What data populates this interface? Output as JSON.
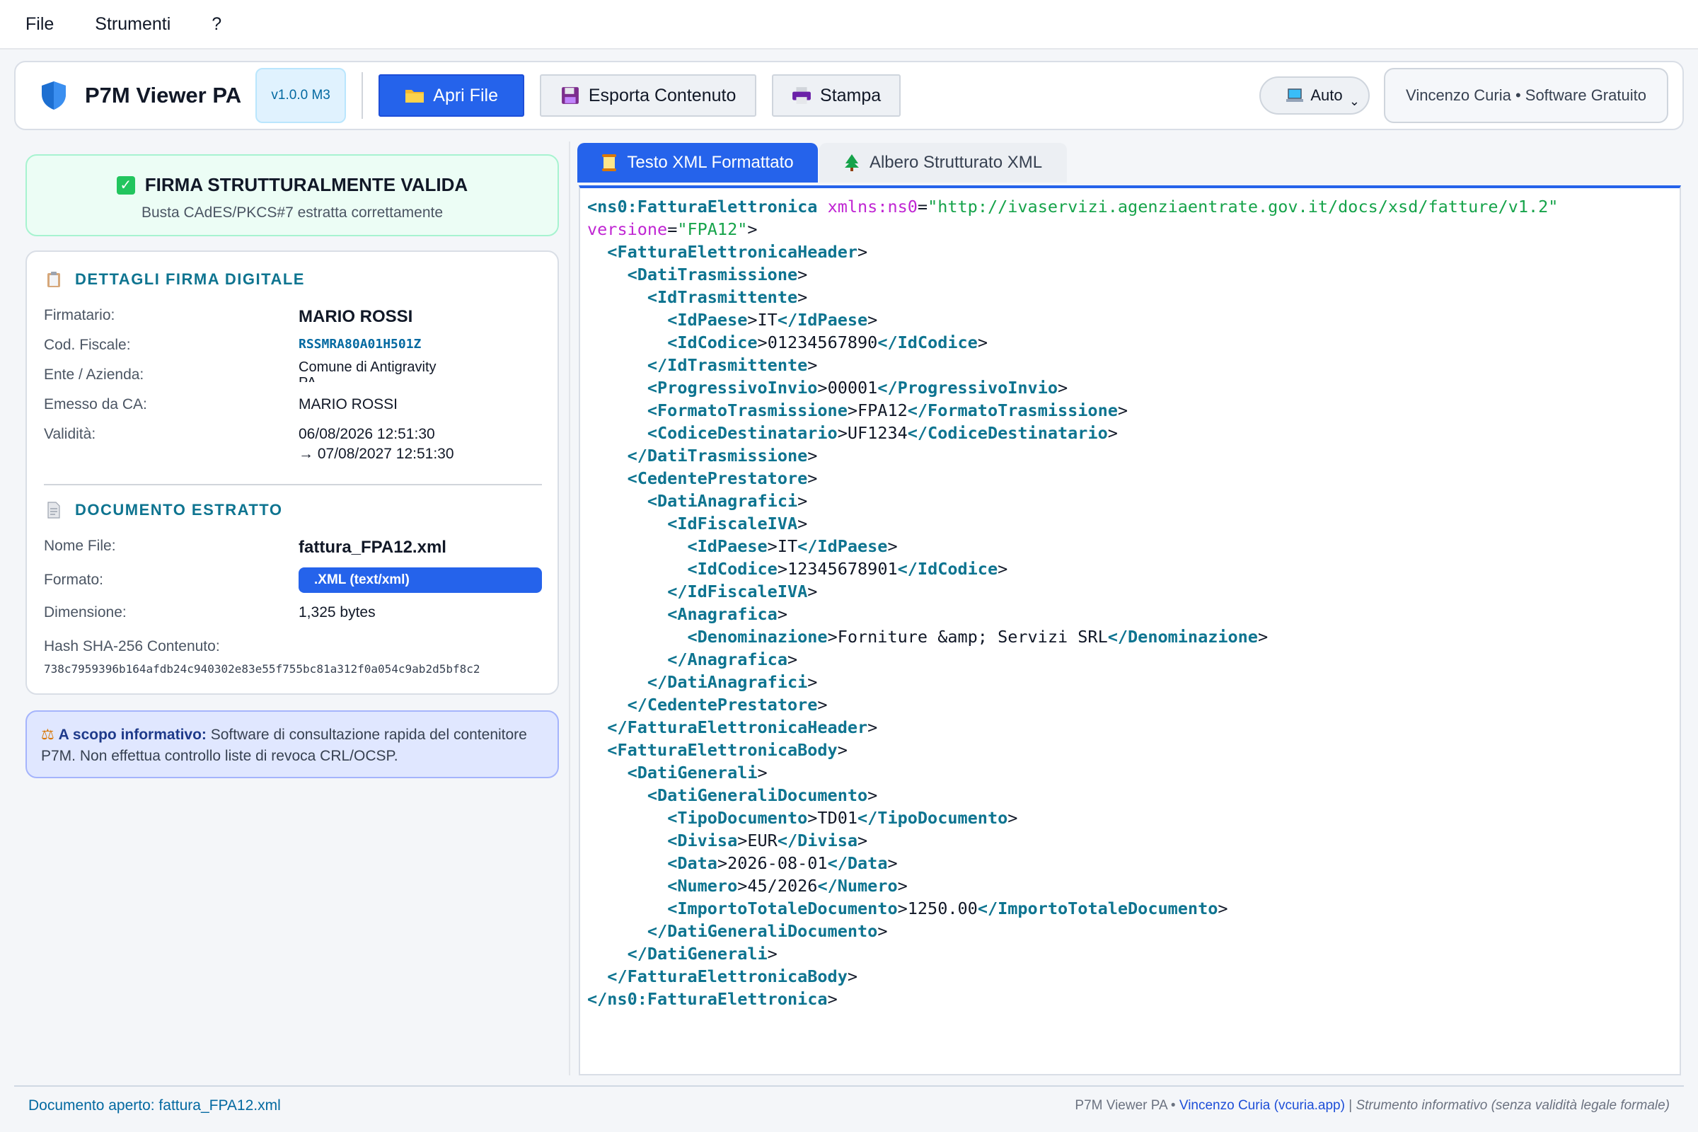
{
  "menubar": {
    "items": [
      "File",
      "Strumenti",
      "?"
    ]
  },
  "toolbar": {
    "app_title": "P7M Viewer PA",
    "version": "v1.0.0 M3",
    "open_label": "Apri File",
    "export_label": "Esporta Contenuto",
    "print_label": "Stampa",
    "theme_selected": "Auto",
    "author": "Vincenzo Curia • Software Gratuito"
  },
  "status": {
    "title": "FIRMA STRUTTURALMENTE VALIDA",
    "subtitle": "Busta CAdES/PKCS#7 estratta correttamente"
  },
  "signature": {
    "section_title": "DETTAGLI FIRMA DIGITALE",
    "signer_label": "Firmatario:",
    "signer": "MARIO ROSSI",
    "cf_label": "Cod. Fiscale:",
    "cf": "RSSMRA80A01H501Z",
    "entity_label": "Ente / Azienda:",
    "entity": "Comune di Antigravity PA",
    "ca_label": "Emesso da CA:",
    "ca": "MARIO ROSSI",
    "validity_label": "Validità:",
    "valid_from": "06/08/2026 12:51:30",
    "valid_to": "→ 07/08/2027 12:51:30"
  },
  "document": {
    "section_title": "DOCUMENTO ESTRATTO",
    "name_label": "Nome File:",
    "name": "fattura_FPA12.xml",
    "format_label": "Formato:",
    "format": ".XML (text/xml)",
    "size_label": "Dimensione:",
    "size": "1,325 bytes",
    "hash_label": "Hash SHA-256 Contenuto:",
    "hash": "738c7959396b164afdb24c940302e83e55f755bc81a312f0a054c9ab2d5bf8c2"
  },
  "info": {
    "bold": "A scopo informativo:",
    "text": " Software di consultazione rapida del contenitore P7M. Non effettua controllo liste di revoca CRL/OCSP."
  },
  "tabs": {
    "formatted": "Testo XML Formattato",
    "tree": "Albero Strutturato XML"
  },
  "xml_lines": [
    {
      "i": 0,
      "t": "open",
      "n": "ns0:FatturaElettronica",
      "a": [
        [
          "xmlns:ns0",
          "\"http://ivaservizi.agenziaentrate.gov.it/docs/xsd/fatture/v1.2\""
        ]
      ],
      "cont": true
    },
    {
      "i": 0,
      "t": "attrcont",
      "a": [
        [
          "versione",
          "\"FPA12\""
        ]
      ]
    },
    {
      "i": 1,
      "t": "open",
      "n": "FatturaElettronicaHeader"
    },
    {
      "i": 2,
      "t": "open",
      "n": "DatiTrasmissione"
    },
    {
      "i": 3,
      "t": "open",
      "n": "IdTrasmittente"
    },
    {
      "i": 4,
      "t": "leaf",
      "n": "IdPaese",
      "v": "IT"
    },
    {
      "i": 4,
      "t": "leaf",
      "n": "IdCodice",
      "v": "01234567890"
    },
    {
      "i": 3,
      "t": "close",
      "n": "IdTrasmittente"
    },
    {
      "i": 3,
      "t": "leaf",
      "n": "ProgressivoInvio",
      "v": "00001"
    },
    {
      "i": 3,
      "t": "leaf",
      "n": "FormatoTrasmissione",
      "v": "FPA12"
    },
    {
      "i": 3,
      "t": "leaf",
      "n": "CodiceDestinatario",
      "v": "UF1234"
    },
    {
      "i": 2,
      "t": "close",
      "n": "DatiTrasmissione"
    },
    {
      "i": 2,
      "t": "open",
      "n": "CedentePrestatore"
    },
    {
      "i": 3,
      "t": "open",
      "n": "DatiAnagrafici"
    },
    {
      "i": 4,
      "t": "open",
      "n": "IdFiscaleIVA"
    },
    {
      "i": 5,
      "t": "leaf",
      "n": "IdPaese",
      "v": "IT"
    },
    {
      "i": 5,
      "t": "leaf",
      "n": "IdCodice",
      "v": "12345678901"
    },
    {
      "i": 4,
      "t": "close",
      "n": "IdFiscaleIVA"
    },
    {
      "i": 4,
      "t": "open",
      "n": "Anagrafica"
    },
    {
      "i": 5,
      "t": "leaf",
      "n": "Denominazione",
      "v": "Forniture &amp; Servizi SRL"
    },
    {
      "i": 4,
      "t": "close",
      "n": "Anagrafica"
    },
    {
      "i": 3,
      "t": "close",
      "n": "DatiAnagrafici"
    },
    {
      "i": 2,
      "t": "close",
      "n": "CedentePrestatore"
    },
    {
      "i": 1,
      "t": "close",
      "n": "FatturaElettronicaHeader"
    },
    {
      "i": 1,
      "t": "open",
      "n": "FatturaElettronicaBody"
    },
    {
      "i": 2,
      "t": "open",
      "n": "DatiGenerali"
    },
    {
      "i": 3,
      "t": "open",
      "n": "DatiGeneraliDocumento"
    },
    {
      "i": 4,
      "t": "leaf",
      "n": "TipoDocumento",
      "v": "TD01"
    },
    {
      "i": 4,
      "t": "leaf",
      "n": "Divisa",
      "v": "EUR"
    },
    {
      "i": 4,
      "t": "leaf",
      "n": "Data",
      "v": "2026-08-01"
    },
    {
      "i": 4,
      "t": "leaf",
      "n": "Numero",
      "v": "45/2026"
    },
    {
      "i": 4,
      "t": "leaf",
      "n": "ImportoTotaleDocumento",
      "v": "1250.00"
    },
    {
      "i": 3,
      "t": "close",
      "n": "DatiGeneraliDocumento"
    },
    {
      "i": 2,
      "t": "close",
      "n": "DatiGenerali"
    },
    {
      "i": 1,
      "t": "close",
      "n": "FatturaElettronicaBody"
    },
    {
      "i": 0,
      "t": "close",
      "n": "ns0:FatturaElettronica"
    }
  ],
  "footer": {
    "open_doc": "Documento aperto: fattura_FPA12.xml",
    "app": "P7M Viewer PA • ",
    "author_link": "Vincenzo Curia (vcuria.app)",
    "sep": " | ",
    "note": "Strumento informativo (senza validità legale formale)"
  },
  "colors": {
    "accent": "#2563eb",
    "success": "#22c55e",
    "tag": "#0e7490",
    "attr": "#c026d3",
    "attr_value": "#16a34a"
  },
  "icons": [
    "shield-icon",
    "folder-icon",
    "floppy-icon",
    "printer-icon",
    "laptop-icon",
    "clipboard-icon",
    "document-icon",
    "scale-icon",
    "scroll-icon",
    "tree-icon"
  ]
}
